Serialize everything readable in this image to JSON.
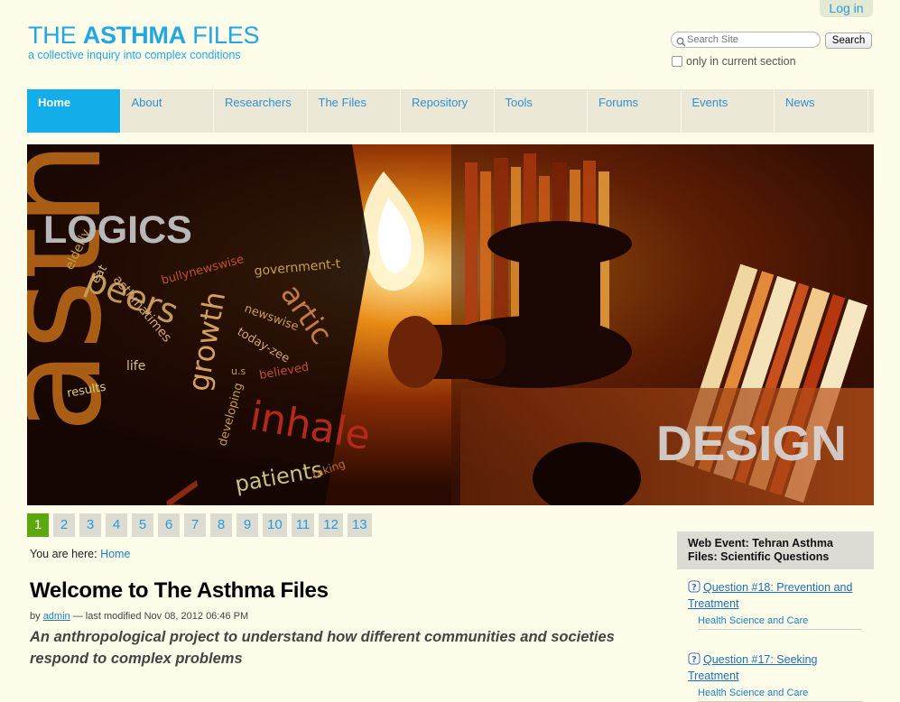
{
  "header": {
    "login_label": "Log in",
    "logo_part1": "THE ",
    "logo_part2": "ASTHMA",
    "logo_part3": " FILES",
    "tagline": "a collective inquiry into complex conditions",
    "search_placeholder": "Search Site",
    "search_button": "Search",
    "current_section_label": "only in current section"
  },
  "nav": {
    "items": [
      {
        "label": "Home",
        "active": true
      },
      {
        "label": "About"
      },
      {
        "label": "Researchers"
      },
      {
        "label": "The Files"
      },
      {
        "label": "Repository"
      },
      {
        "label": "Tools"
      },
      {
        "label": "Forums"
      },
      {
        "label": "Events"
      },
      {
        "label": "News"
      }
    ]
  },
  "banner": {
    "heading_top": "LOGICS",
    "heading_bottom": "DESIGN",
    "words": [
      "elderly",
      "eat",
      "asthmatimes",
      "bullynewswise",
      "government-t",
      "peers",
      "growth",
      "newswise",
      "artic",
      "today-zee",
      "life",
      "results",
      "u.s",
      "believed",
      "inhale",
      "developing",
      "patients",
      "taking",
      "asth",
      "vitam"
    ]
  },
  "pager": {
    "active": "1",
    "pages": [
      "1",
      "2",
      "3",
      "4",
      "5",
      "6",
      "7",
      "8",
      "9",
      "10",
      "11",
      "12",
      "13"
    ]
  },
  "breadcrumb": {
    "prefix": "You are here: ",
    "home": "Home"
  },
  "article": {
    "title": "Welcome to The Asthma Files",
    "by": "by ",
    "author": "admin",
    "modified": " — last modified Nov 08, 2012 06:46 PM",
    "description": "An anthropological project to understand how different communities and societies respond to complex problems"
  },
  "sidebar": {
    "heading": "Web Event: Tehran Asthma Files: Scientific Questions",
    "items": [
      {
        "title": "Question #18: Prevention and Treatment",
        "category": "Health Science and Care"
      },
      {
        "title": "Question #17: Seeking Treatment",
        "category": "Health Science and Care"
      }
    ]
  },
  "colors": {
    "brand_blue": "#23a7e4",
    "nav_active": "#13aeea",
    "pager_active": "#5aa70e",
    "background": "#fefde9"
  }
}
